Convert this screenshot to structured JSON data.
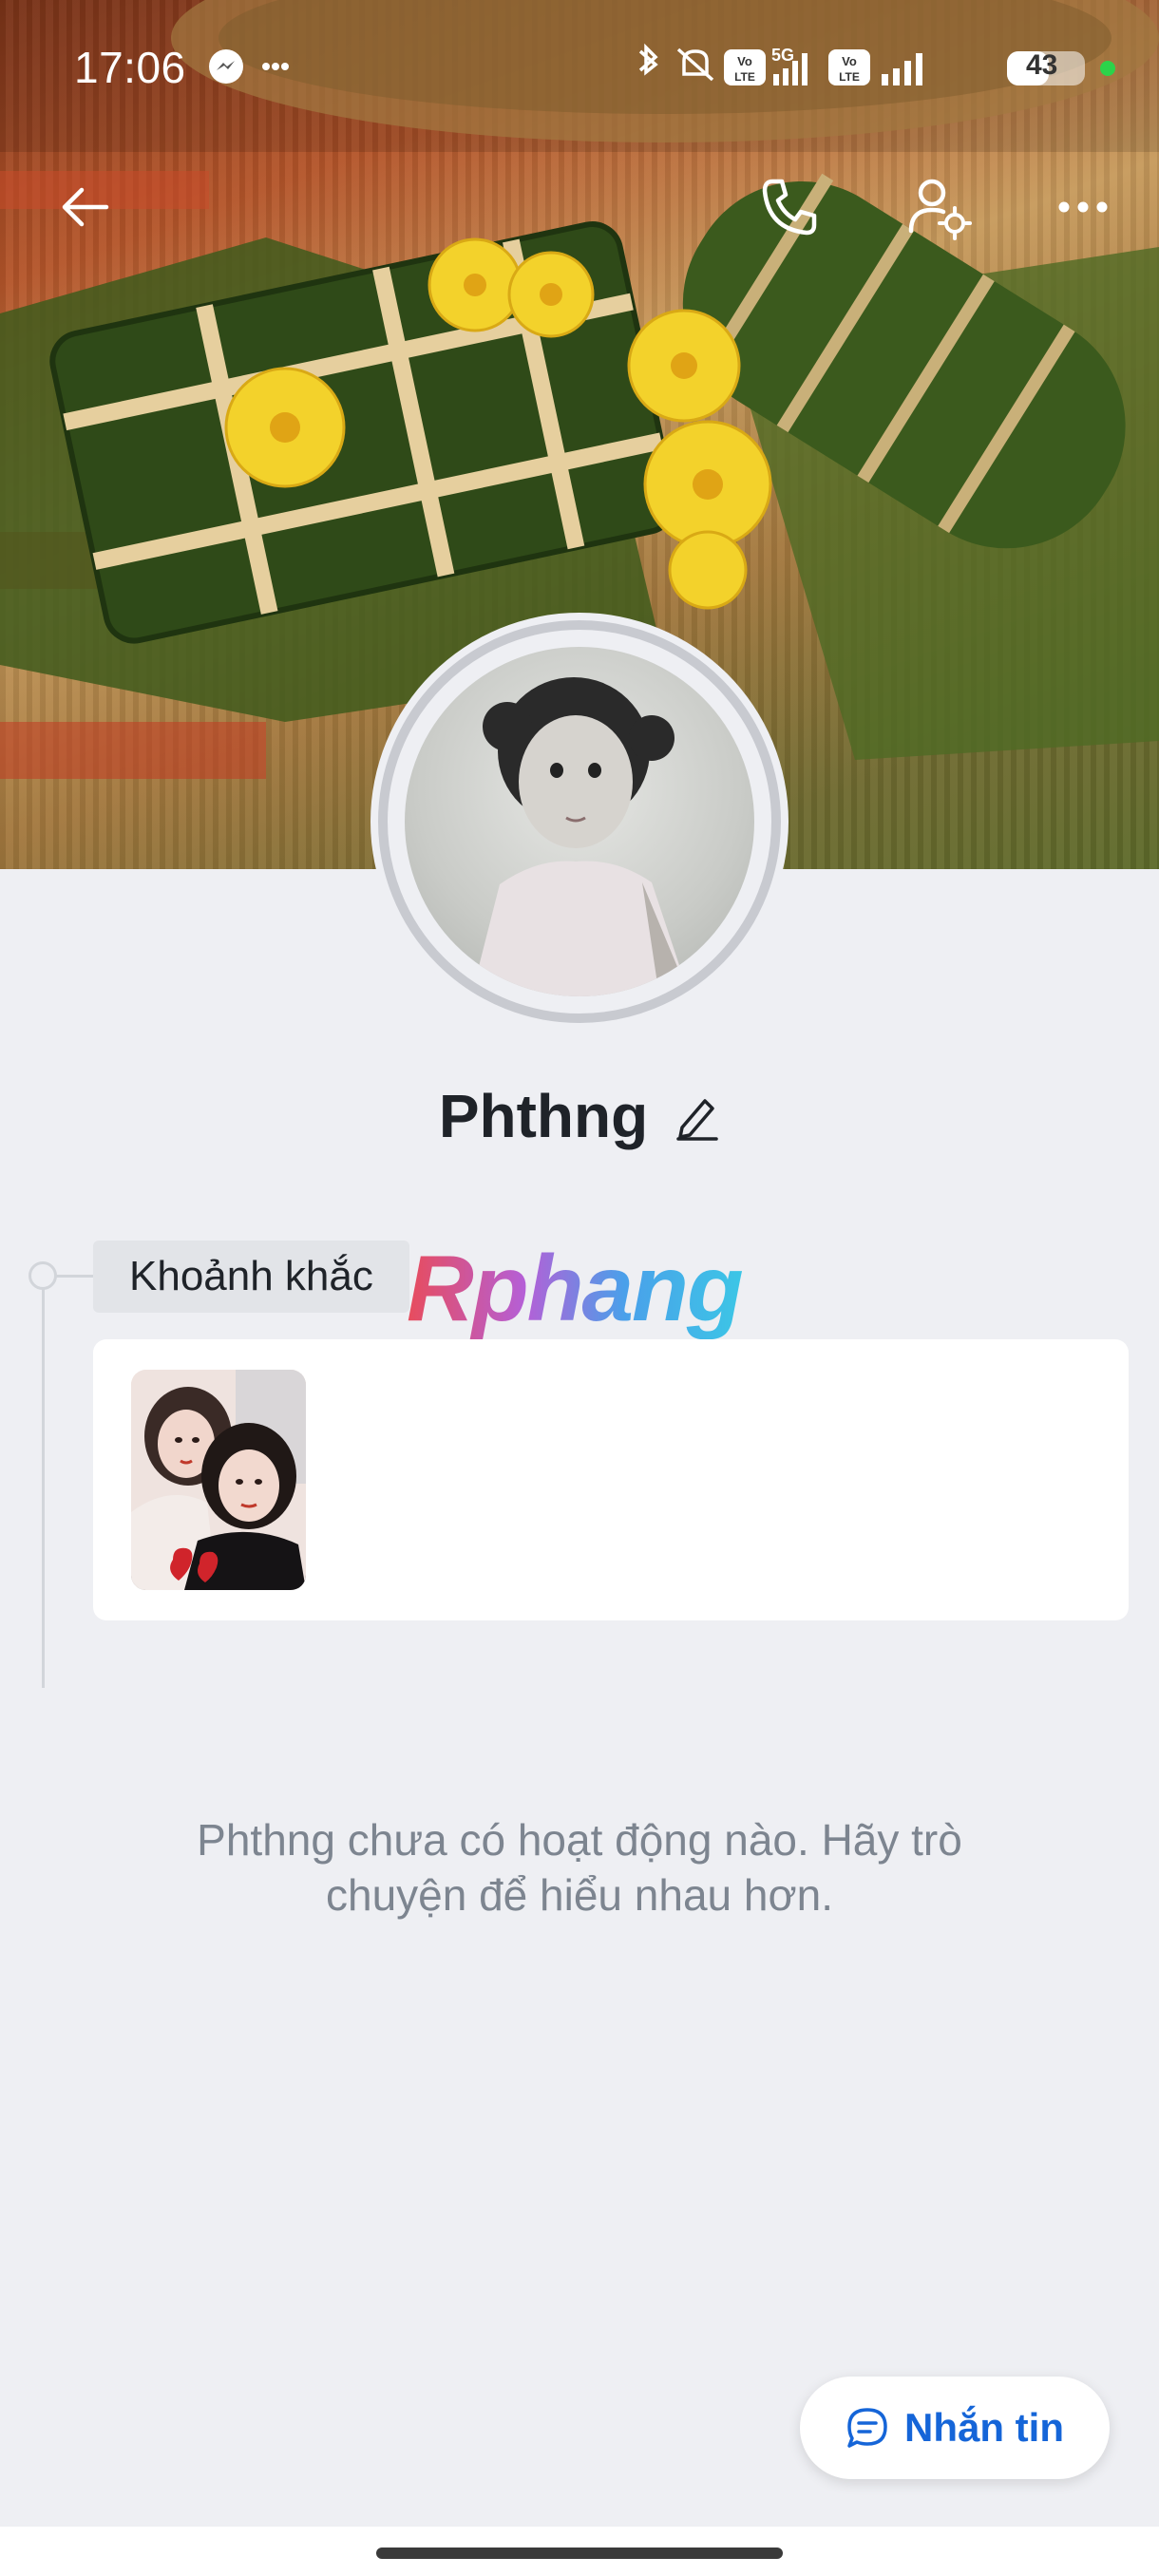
{
  "status_bar": {
    "time": "17:06",
    "battery": "43",
    "icons": [
      "messenger-icon",
      "more-dots-icon",
      "bluetooth-icon",
      "mute-icon",
      "volte-icon",
      "5g-signal-icon",
      "volte-icon",
      "signal-icon",
      "battery-icon",
      "green-dot-indicator"
    ]
  },
  "toolbar": {
    "back_icon": "arrow-left-icon",
    "call_icon": "phone-icon",
    "settings_icon": "user-settings-icon",
    "more_icon": "more-horizontal-icon"
  },
  "profile": {
    "name": "Phthng",
    "edit_icon": "pencil-icon"
  },
  "moments": {
    "label": "Khoảnh khắc",
    "watermark": "Rphang"
  },
  "empty_state": {
    "text": "Phthng chưa có hoạt động nào. Hãy trò chuyện để hiểu nhau hơn."
  },
  "message_button": {
    "label": "Nhắn tin",
    "icon": "chat-bubble-icon"
  },
  "colors": {
    "background": "#eeeff3",
    "accent": "#1565d8",
    "muted_text": "#7d8590"
  }
}
